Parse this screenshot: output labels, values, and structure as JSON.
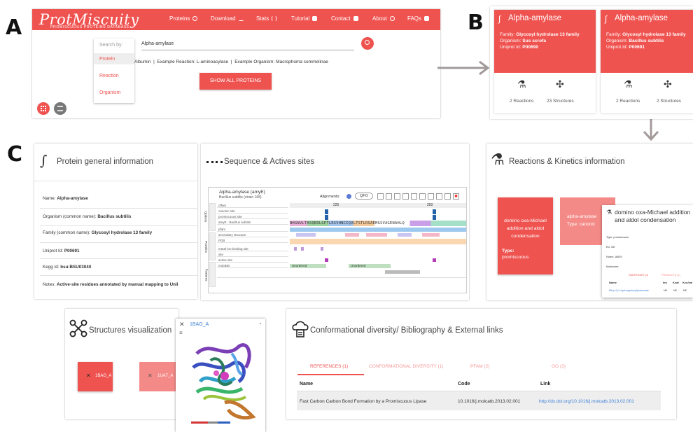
{
  "labels": {
    "a": "A",
    "b": "B",
    "c": "C"
  },
  "header": {
    "logo": "ProtMiscuity",
    "logo_subtitle": "PROMISCUOUS PROTEINS DATABASE",
    "nav": [
      "Proteins",
      "Download",
      "Stats",
      "Tutorial",
      "Contact",
      "About",
      "FAQs"
    ]
  },
  "search": {
    "search_by_label": "Search by:",
    "options": [
      "Protein",
      "Reaction",
      "Organism"
    ],
    "value": "Alpha-amylase",
    "examples": "Albumin  |  Example Reaction: L-aminoacylase  |  Example Organism: Macrophoma commelinae",
    "show_all_button": "SHOW ALL PROTEINS"
  },
  "cards": [
    {
      "title": "Alpha-amylase",
      "family_label": "Family:",
      "family": "Glycosyl hydrolase 13 family",
      "organism_label": "Organism:",
      "organism": "Sus scrofa",
      "uniprot_label": "Uniprot Id:",
      "uniprot": "P00690",
      "reactions": "2 Reactions",
      "structures": "23 Structures"
    },
    {
      "title": "Alpha-amylase",
      "family_label": "Family:",
      "family": "Glycosyl hydrolase 13 family",
      "organism_label": "Organism:",
      "organism": "Bacillus subtilis",
      "uniprot_label": "Uniprot Id:",
      "uniprot": "P00691",
      "reactions": "2 Reactions",
      "structures": "2 Structures"
    }
  ],
  "general": {
    "title": "Protein general information",
    "rows": [
      {
        "label": "Name:",
        "value": "Alpha-amylase"
      },
      {
        "label": "Organism (common name):",
        "value": "Bacillus subtilis"
      },
      {
        "label": "Family (common name):",
        "value": "Glycosyl hydrolase 13 family"
      },
      {
        "label": "Uniprot Id:",
        "value": "P00691"
      },
      {
        "label": "Kegg Id:",
        "value": "bsu:BSU03040"
      },
      {
        "label": "Notes:",
        "value": "Active-site residues annotated by manual mapping to Unil"
      }
    ]
  },
  "sequence": {
    "title": "Sequence & Actives sites",
    "protein": "Alpha-amylase (amyE)",
    "organism": "Bacillus subtilis (strain 168)",
    "alignments_label": "Alignments:",
    "qfo": "QFO",
    "side_tabs": [
      "Options",
      "Proteins",
      "Features"
    ],
    "tracks": [
      "offset",
      "canonic site",
      "promiscuous site",
      "amyE - Bacillus subtilis",
      "pfam",
      "secondary structure",
      "PDB",
      "metal-ion-binding site",
      "site",
      "active site",
      "mobiDB"
    ],
    "ticks": [
      "225",
      "250"
    ],
    "sequence_letters": "NHGNVLTASQEDLGPTLRSVHNCIQVLTSTLRSAEMGSVAGENAHLQ",
    "mobidb_labels": [
      "Unordered",
      "Unordered"
    ]
  },
  "reactions": {
    "title": "Reactions & Kinetics information",
    "card1": "domino oxa-Michael addition and aldol condensation",
    "card1_type_label": "Type:",
    "card1_type": "promiscuous",
    "card2": "alpha-amylase",
    "card2_type": "Type: canonic",
    "popup_title": "domino oxa-Michael addition and aldol condensation",
    "popup_lines": [
      "Type: promiscuous",
      "EC: NE",
      "Notes: 18693",
      "Molecules:"
    ],
    "popup_tabs": [
      "SUBSTRATE (1)",
      "PRODUCTS (1)"
    ],
    "popup_cols": [
      "Name",
      "km",
      "Kcat",
      "Kcc/km"
    ],
    "popup_row": [
      "Ethyl 4-(4-hydroxyphenyl)butanoate",
      "NE",
      "NE",
      "NE"
    ]
  },
  "structures": {
    "title": "Structures visualization",
    "items": [
      "1BAG_A",
      "1UA7_A"
    ],
    "viewer_title": "1BAG_A"
  },
  "conformational": {
    "title": "Conformational diversity/ Bibliography & External links",
    "tabs": [
      "REFERENCES (1)",
      "CONFORMATIONAL DIVERSITY (1)",
      "PFAM (2)",
      "GO (3)"
    ],
    "columns": [
      "Name",
      "Code",
      "Link"
    ],
    "row": [
      "Fast Carbon Carbon Bond Formation by a Promiscuous Lipase",
      "10.1016/j.molcatb.2013.02.001",
      "http://dx.doi.org/10.1016/j.molcatb.2013.02.001"
    ]
  },
  "colors": {
    "accent": "#ef5350",
    "accent_light": "#f48a87"
  }
}
